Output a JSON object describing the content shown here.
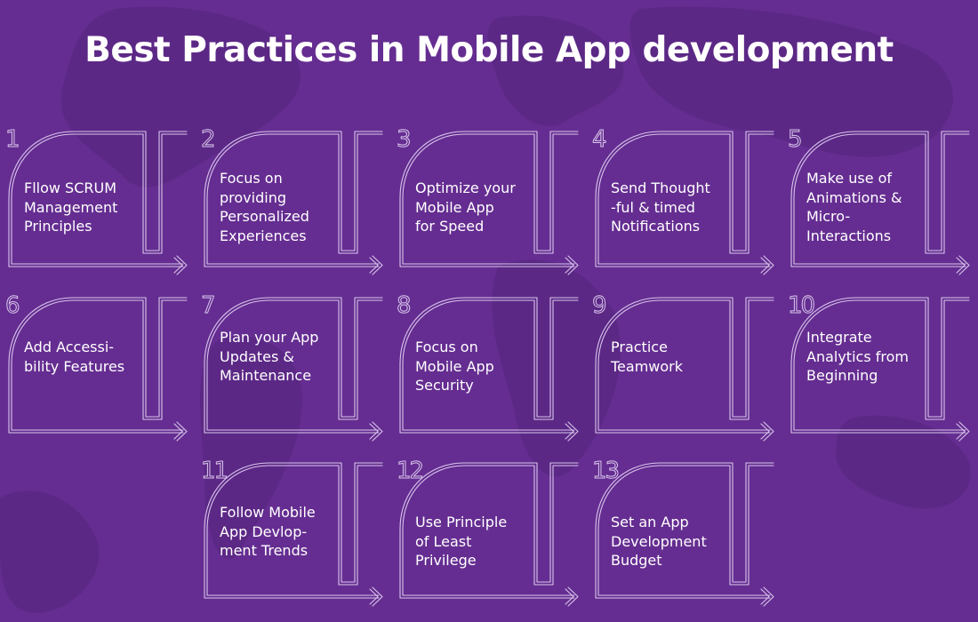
{
  "page": {
    "title": "Best Practices in Mobile App development",
    "colors": {
      "background": "#652d91",
      "map_shade": "#5a2884",
      "outline": "#d9c6ec",
      "text": "#ffffff"
    }
  },
  "cards": [
    {
      "number": "1",
      "label": "Fllow SCRUM\nManagement\nPrinciples"
    },
    {
      "number": "2",
      "label": "Focus on\nproviding\nPersonalized\nExperiences"
    },
    {
      "number": "3",
      "label": "Optimize your\nMobile App\nfor Speed"
    },
    {
      "number": "4",
      "label": "Send Thought\n-ful & timed\nNotifications"
    },
    {
      "number": "5",
      "label": "Make use of\nAnimations &\nMicro-\nInteractions"
    },
    {
      "number": "6",
      "label": "Add Accessi-\nbility Features"
    },
    {
      "number": "7",
      "label": "Plan your App\nUpdates &\nMaintenance"
    },
    {
      "number": "8",
      "label": "Focus on\nMobile App\nSecurity"
    },
    {
      "number": "9",
      "label": "Practice\nTeamwork"
    },
    {
      "number": "10",
      "label": "Integrate\nAnalytics from\nBeginning"
    },
    {
      "number": "11",
      "label": "Follow Mobile\nApp Devlop-\nment Trends"
    },
    {
      "number": "12",
      "label": "Use Principle\nof Least\nPrivilege"
    },
    {
      "number": "13",
      "label": "Set an App\nDevelopment\nBudget"
    }
  ]
}
